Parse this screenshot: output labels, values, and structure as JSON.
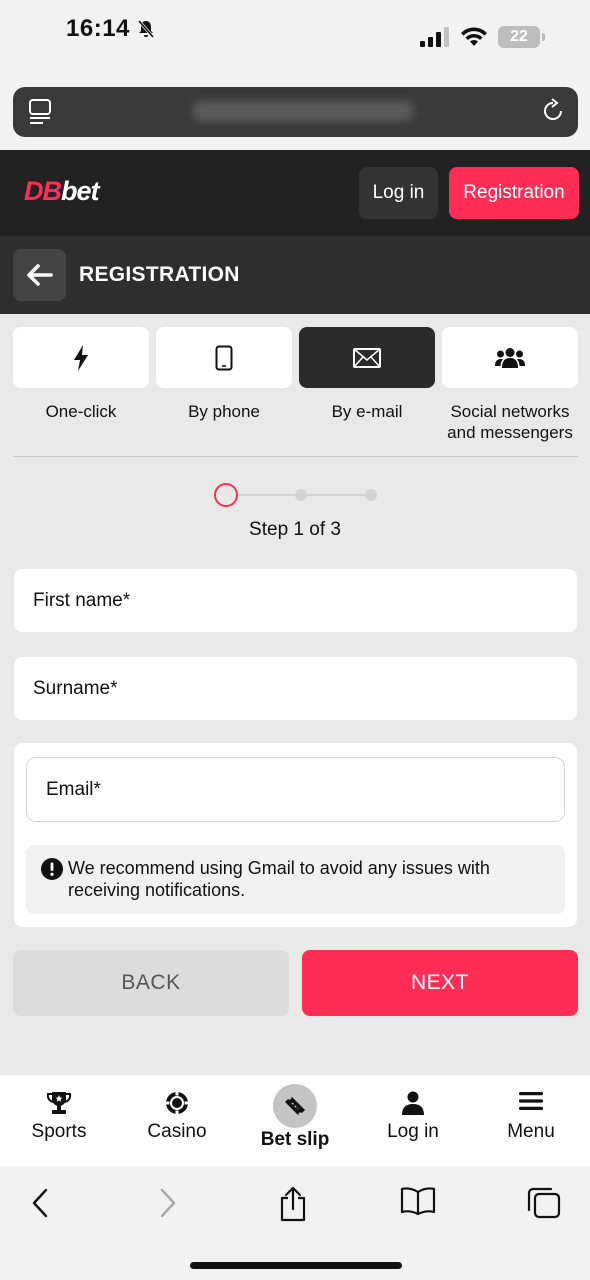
{
  "status_bar": {
    "time": "16:14",
    "battery": "22"
  },
  "header": {
    "logo_part1": "DB",
    "logo_part2": "bet",
    "login_label": "Log in",
    "registration_label": "Registration"
  },
  "page": {
    "title": "REGISTRATION"
  },
  "methods": [
    {
      "label": "One-click",
      "icon": "lightning-icon",
      "active": false
    },
    {
      "label": "By phone",
      "icon": "phone-icon",
      "active": false
    },
    {
      "label": "By e-mail",
      "icon": "envelope-icon",
      "active": true
    },
    {
      "label": "Social networks and messengers",
      "icon": "users-icon",
      "active": false
    }
  ],
  "steps": {
    "text": "Step 1 of 3",
    "current": 1,
    "total": 3
  },
  "form": {
    "first_name_placeholder": "First name*",
    "surname_placeholder": "Surname*",
    "email_placeholder": "Email*",
    "notice": "We recommend using Gmail to avoid any issues with receiving notifications.",
    "back_label": "BACK",
    "next_label": "NEXT"
  },
  "bottom_nav": [
    {
      "label": "Sports",
      "icon": "trophy-icon"
    },
    {
      "label": "Casino",
      "icon": "casino-chip-icon"
    },
    {
      "label": "Bet slip",
      "icon": "ticket-icon"
    },
    {
      "label": "Log in",
      "icon": "user-icon"
    },
    {
      "label": "Menu",
      "icon": "menu-icon"
    }
  ],
  "colors": {
    "accent": "#ff2d55",
    "header_bg": "#222222",
    "title_bg": "#2e2e2e",
    "page_bg": "#e9e9e9"
  }
}
